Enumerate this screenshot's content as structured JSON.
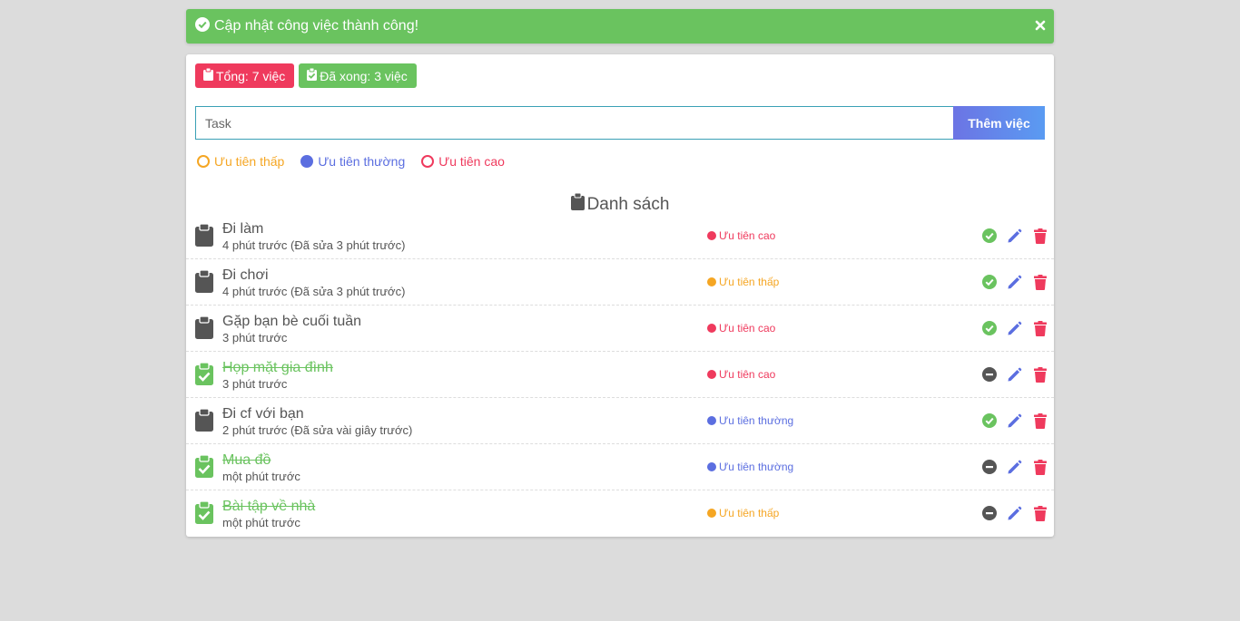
{
  "alert": {
    "message": "Cập nhật công việc thành công!",
    "color": "#6ac35f"
  },
  "badges": {
    "total": "Tổng: 7 việc",
    "done": "Đã xong: 3 việc"
  },
  "add_task": {
    "placeholder": "Task",
    "button_label": "Thêm việc"
  },
  "priority_options": [
    {
      "label": "Ưu tiên thấp",
      "color": "#f5a623",
      "selected": false
    },
    {
      "label": "Ưu tiên thường",
      "color": "#5b6ee0",
      "selected": true
    },
    {
      "label": "Ưu tiên cao",
      "color": "#ef3a5d",
      "selected": false
    }
  ],
  "list": {
    "title": "Danh sách",
    "items": [
      {
        "name": "Đi làm",
        "time": "4 phút trước (Đã sửa 3 phút trước)",
        "priority": "Ưu tiên cao",
        "priority_color": "#ef3a5d",
        "done": false
      },
      {
        "name": "Đi chơi",
        "time": "4 phút trước (Đã sửa 3 phút trước)",
        "priority": "Ưu tiên thấp",
        "priority_color": "#f5a623",
        "done": false
      },
      {
        "name": "Gặp bạn bè cuối tuần",
        "time": "3 phút trước",
        "priority": "Ưu tiên cao",
        "priority_color": "#ef3a5d",
        "done": false
      },
      {
        "name": "Họp mặt gia đình",
        "time": "3 phút trước",
        "priority": "Ưu tiên cao",
        "priority_color": "#ef3a5d",
        "done": true
      },
      {
        "name": "Đi cf với bạn",
        "time": "2 phút trước (Đã sửa vài giây trước)",
        "priority": "Ưu tiên thường",
        "priority_color": "#5b6ee0",
        "done": false
      },
      {
        "name": "Mua đồ",
        "time": "một phút trước",
        "priority": "Ưu tiên thường",
        "priority_color": "#5b6ee0",
        "done": true
      },
      {
        "name": "Bài tập về nhà",
        "time": "một phút trước",
        "priority": "Ưu tiên thấp",
        "priority_color": "#f5a623",
        "done": true
      }
    ]
  },
  "colors": {
    "success": "#6ac35f",
    "danger": "#ef3a5d",
    "edit": "#5b6ee0",
    "dark": "#555555"
  }
}
